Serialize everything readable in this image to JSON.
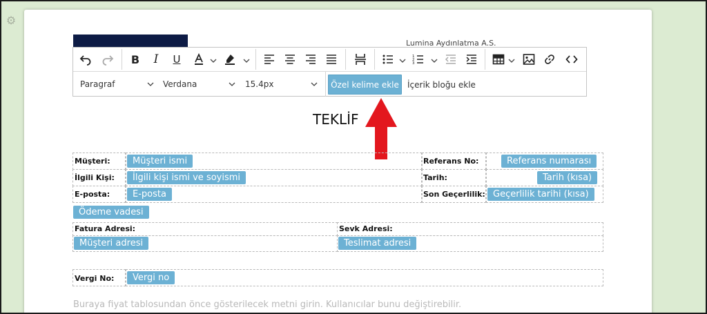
{
  "company": "Lumina Aydınlatma A.S.",
  "toolbar": {
    "paragraph": "Paragraf",
    "font": "Verdana",
    "size": "15.4px",
    "special_word_button": "Özel kelime ekle",
    "content_block_button": "İçerik bloğu ekle"
  },
  "document": {
    "title": "TEKLİF",
    "customer_label": "Müşteri:",
    "customer_tag": "Müşteri ismi",
    "contact_label": "İlgili Kişi:",
    "contact_tag": "İlgili kişi ismi ve soyismi",
    "email_label": "E-posta:",
    "email_tag": "E-posta",
    "reference_label": "Referans No:",
    "reference_tag": "Referans numarası",
    "date_label": "Tarih:",
    "date_tag": "Tarih (kısa)",
    "validity_label": "Son Geçerlilik:",
    "validity_tag": "Geçerlilik tarihi (kısa)",
    "payment_tag": "Ödeme vadesi",
    "billing_label": "Fatura Adresi:",
    "billing_tag": "Müşteri adresi",
    "shipping_label": "Sevk Adresi:",
    "shipping_tag": "Teslimat adresi",
    "tax_label": "Vergi No:",
    "tax_tag": "Vergi no",
    "placeholder_text": "Buraya fiyat tablosundan önce gösterilecek metni girin. Kullanıcılar bunu değiştirebilir."
  },
  "colors": {
    "tag_blue": "#6cb1d4",
    "logo_navy": "#0d1b45",
    "arrow_red": "#e3171e",
    "frame_green": "#dcebd2"
  }
}
